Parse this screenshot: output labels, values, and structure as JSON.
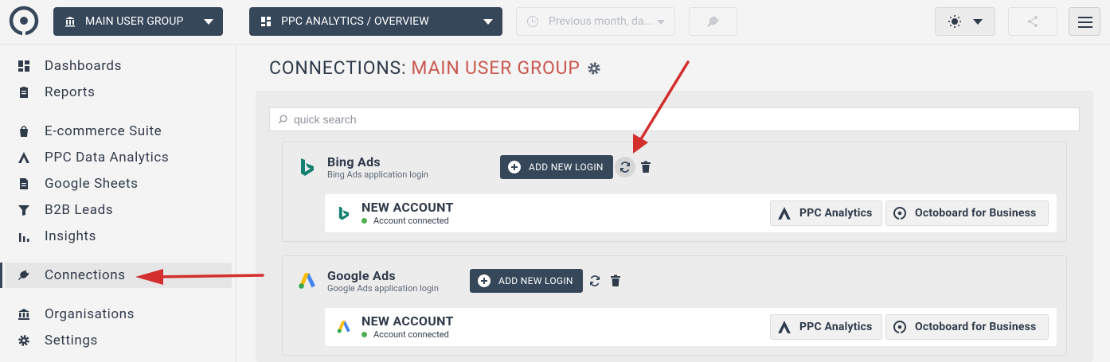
{
  "topbar": {
    "group_dropdown": "MAIN USER GROUP",
    "dashboard_dropdown": "PPC ANALYTICS / OVERVIEW",
    "date_dropdown": "Previous month, da..."
  },
  "sidebar": {
    "items": [
      {
        "label": "Dashboards",
        "icon": "dashboard-icon"
      },
      {
        "label": "Reports",
        "icon": "clipboard-icon"
      },
      {
        "label": "E-commerce Suite",
        "icon": "shopping-bag-icon"
      },
      {
        "label": "PPC Data Analytics",
        "icon": "ppc-a-icon"
      },
      {
        "label": "Google Sheets",
        "icon": "document-icon"
      },
      {
        "label": "B2B Leads",
        "icon": "funnel-icon"
      },
      {
        "label": "Insights",
        "icon": "bar-chart-icon"
      },
      {
        "label": "Connections",
        "icon": "plug-icon",
        "active": true
      },
      {
        "label": "Organisations",
        "icon": "bank-icon"
      },
      {
        "label": "Settings",
        "icon": "gear-icon"
      }
    ]
  },
  "page": {
    "title": "CONNECTIONS:",
    "group": "MAIN USER GROUP",
    "search_placeholder": "quick search"
  },
  "connections": [
    {
      "name": "Bing Ads",
      "subtitle": "Bing Ads application login",
      "add_button": "ADD NEW LOGIN",
      "account": {
        "name": "NEW ACCOUNT",
        "status": "Account connected"
      },
      "tags": [
        "PPC Analytics",
        "Octoboard for Business"
      ]
    },
    {
      "name": "Google Ads",
      "subtitle": "Google Ads application login",
      "add_button": "ADD NEW LOGIN",
      "account": {
        "name": "NEW ACCOUNT",
        "status": "Account connected"
      },
      "tags": [
        "PPC Analytics",
        "Octoboard for Business"
      ]
    }
  ],
  "colors": {
    "navy": "#37475a",
    "accent_red": "#c9574f",
    "arrow_red": "#d32f2f",
    "status_green": "#4caf50"
  }
}
